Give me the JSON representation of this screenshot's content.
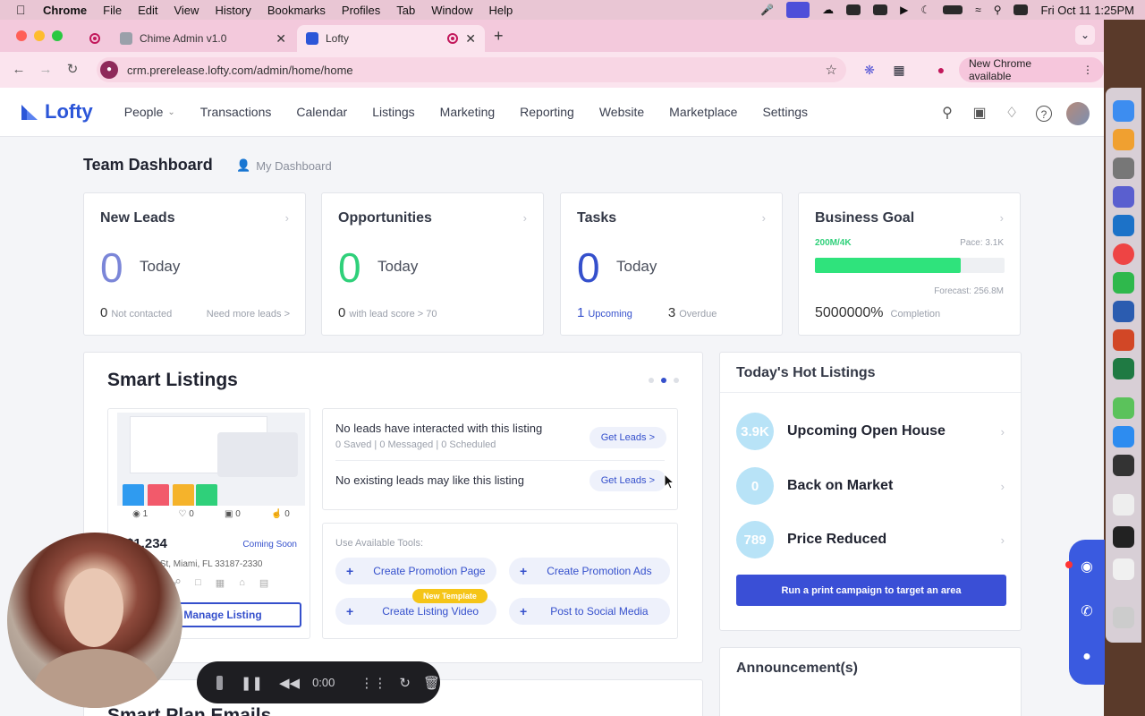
{
  "menubar": {
    "items": [
      "Chrome",
      "File",
      "Edit",
      "View",
      "History",
      "Bookmarks",
      "Profiles",
      "Tab",
      "Window",
      "Help"
    ],
    "clock": "Fri Oct 11  1:25PM"
  },
  "browser": {
    "tabs": [
      {
        "title": "Chime Admin v1.0"
      },
      {
        "title": "Lofty"
      }
    ],
    "url": "crm.prerelease.lofty.com/admin/home/home",
    "new_chrome": "New Chrome available"
  },
  "app": {
    "logo": "Lofty",
    "nav": [
      "People",
      "Transactions",
      "Calendar",
      "Listings",
      "Marketing",
      "Reporting",
      "Website",
      "Marketplace",
      "Settings"
    ]
  },
  "dashboard": {
    "title": "Team Dashboard",
    "my_dashboard": "My Dashboard",
    "cards": {
      "new_leads": {
        "title": "New Leads",
        "value": "0",
        "today": "Today",
        "count": "0",
        "count_label": "Not contacted",
        "link": "Need more leads >",
        "color": "#7b86d8"
      },
      "opportunities": {
        "title": "Opportunities",
        "value": "0",
        "today": "Today",
        "count": "0",
        "count_label": "with lead score > 70",
        "color": "#2fd07a"
      },
      "tasks": {
        "title": "Tasks",
        "value": "0",
        "today": "Today",
        "upcoming_count": "1",
        "upcoming": "Upcoming",
        "overdue_count": "3",
        "overdue": "Overdue",
        "color": "#3550cc"
      },
      "business_goal": {
        "title": "Business Goal",
        "progress_label": "200M/4K",
        "pace": "Pace: 3.1K",
        "forecast": "Forecast: 256.8M",
        "completion_value": "5000000%",
        "completion": "Completion",
        "progress_fraction": 0.77
      }
    }
  },
  "smart_listings": {
    "title": "Smart Listings",
    "listing": {
      "stats": [
        "1",
        "0",
        "0",
        "0"
      ],
      "price": "$1,234",
      "status": "Coming Soon",
      "address": "200th St, Miami, FL 33187-2330",
      "manage": "Manage Listing"
    },
    "insights": [
      {
        "text": "No leads have interacted with this listing",
        "sub": "0 Saved | 0 Messaged | 0 Scheduled",
        "button": "Get Leads >"
      },
      {
        "text": "No existing leads may like this listing",
        "sub": "",
        "button": "Get Leads >"
      }
    ],
    "tools": {
      "label": "Use Available Tools:",
      "buttons": [
        "Create Promotion Page",
        "Create Promotion Ads",
        "Create Listing Video",
        "Post to Social Media"
      ],
      "badge": "New Template"
    }
  },
  "hot_listings": {
    "title": "Today's Hot Listings",
    "rows": [
      {
        "count": "3.9K",
        "label": "Upcoming Open House"
      },
      {
        "count": "0",
        "label": "Back on Market"
      },
      {
        "count": "789",
        "label": "Price Reduced"
      }
    ],
    "campaign": "Run a print campaign to target an area"
  },
  "announcements": {
    "title": "Announcement(s)"
  },
  "smart_plan": {
    "title": "Smart Plan Emails"
  },
  "player": {
    "time": "0:00"
  }
}
